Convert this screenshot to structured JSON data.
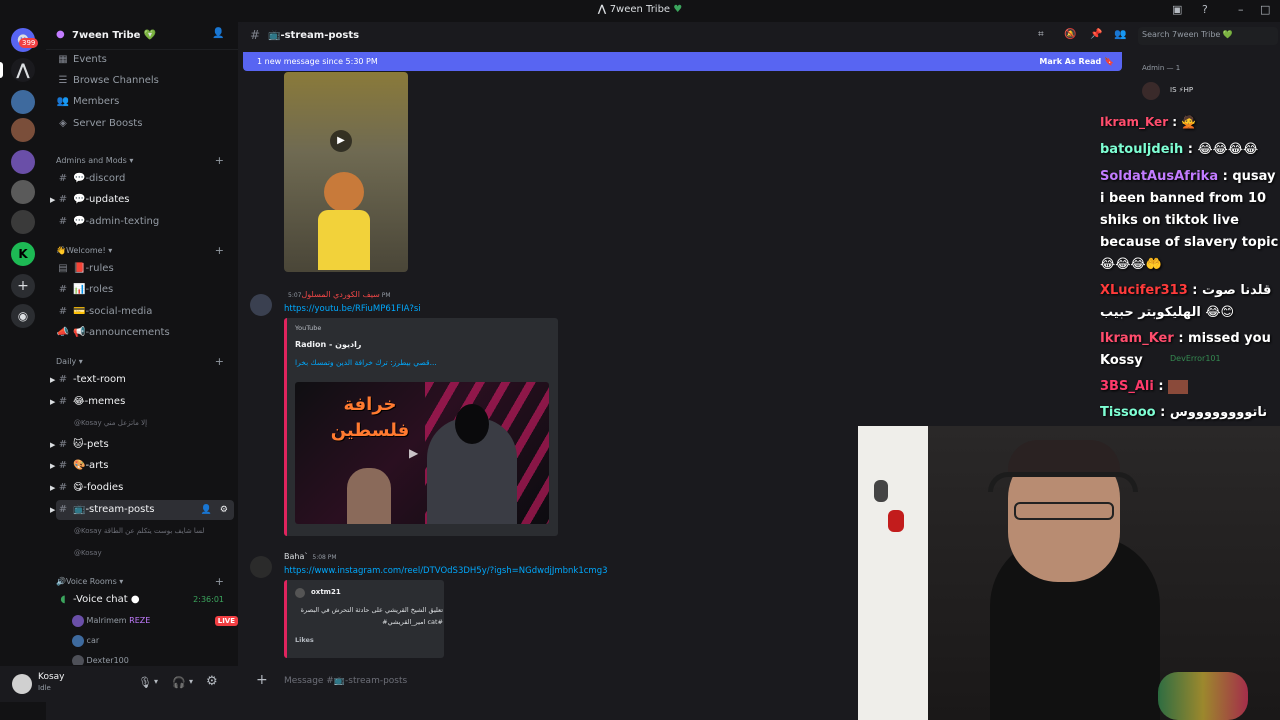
{
  "window": {
    "title": "7ween Tribe",
    "minimize": "–",
    "maximize": "□",
    "close": "✕"
  },
  "rail": {
    "unread_count": "399"
  },
  "server": {
    "name": "7ween Tribe 💚"
  },
  "nav": {
    "events": "Events",
    "browse_channels": "Browse Channels",
    "members": "Members",
    "server_boosts": "Server Boosts"
  },
  "categories": {
    "admins": "Admins and Mods",
    "welcome": "👋Welcome!",
    "daily": "Daily",
    "voice": "🔊Voice Rooms"
  },
  "channels": {
    "discord": "💬-discord",
    "updates": "💬-updates",
    "admin_texting": "💬-admin-texting",
    "rules": "📕-rules",
    "roles": "📊-roles",
    "social_media": "💳-social-media",
    "announcements": "📢-announcements",
    "text_room": "-text-room",
    "memes": "😂-memes",
    "memes_sub": "@Kosay إلا ماتزعل مني",
    "pets": "🐱-pets",
    "arts": "🎨-arts",
    "foodies": "😋-foodies",
    "stream_posts": "📺-stream-posts",
    "stream_sub1": "@Kosay لسا شايف بوست يتكلم عن الطاقة",
    "stream_sub2": "@Kosay",
    "voice_chat": "-Voice chat",
    "voice_time": "2:36:01",
    "voice_user1": "Malrimem",
    "voice_user1_tag": "REZE",
    "voice_live": "LIVE",
    "voice_user2": "car",
    "voice_user3": "Dexter100"
  },
  "user": {
    "name": "Kosay",
    "status": "Idle"
  },
  "channel": {
    "title": "📺-stream-posts",
    "search_placeholder": "Search 7ween Tribe 💚",
    "new_message": "1 new message since 5:30 PM",
    "mark_as_read": "Mark As Read"
  },
  "messages": [
    {
      "author": "سيف الكوردي المسلول",
      "time": "5:07 PM",
      "link": "https://youtu.be/RFiuMP61FIA?si",
      "embed_provider": "YouTube",
      "embed_author": "Radion - راديون",
      "embed_title": "قصي بيطرز: ترك خرافة الدين وتمسك بخرا...",
      "thumb_text": "خرافة فلسطين"
    },
    {
      "author": "Baha`",
      "time": "5:08 PM",
      "link": "https://www.instagram.com/reel/DTVOdS3DH5y/?igsh=NGdwdjJmbnk1cmg3",
      "embed_author": "oxtm21",
      "embed_text_1": "تعليق الشيخ القريشي على حادثة التحرش في البصرة",
      "embed_text_2": "#امير_القريشي cat#",
      "embed_footer": "Likes"
    }
  ],
  "composer": {
    "placeholder": "Message #📺-stream-posts"
  },
  "members": {
    "header": "Admin — 1",
    "member_name": "IS ⚡HP"
  },
  "chat_overlay": [
    {
      "name": "Ikram_Ker",
      "color": "#ff4d6d",
      "text": ": 🙅"
    },
    {
      "name": "batouljdeih",
      "color": "#7fffd4",
      "text": ": 😂😂😂😂"
    },
    {
      "name": "SoldatAusAfrika",
      "color": "#c27cff",
      "text": ": qusay i been banned from 10 shiks on tiktok live because of slavery topic 😂😂😂🤲"
    },
    {
      "name": "XLucifer313",
      "color": "#ff3b3b",
      "text": ": قلدنا صوت الهليكوبتر حبيب 😂😊"
    },
    {
      "name": "Ikram_Ker",
      "color": "#ff4d6d",
      "text": ": missed you Kossy"
    },
    {
      "name": "3BS_Ali",
      "color": "#ff3b6b",
      "text": ":"
    },
    {
      "name": "Tissooo",
      "color": "#7fffd4",
      "text": ": ناتووووووووس"
    }
  ],
  "overlay_faint": {
    "user": "DevError101"
  }
}
